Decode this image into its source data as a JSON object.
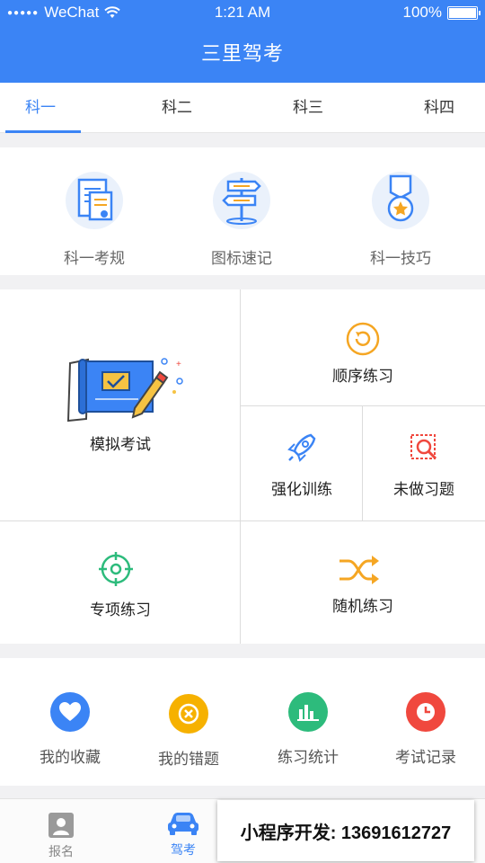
{
  "status_bar": {
    "carrier": "WeChat",
    "time": "1:21 AM",
    "battery": "100%"
  },
  "app_title": "三里驾考",
  "tabs": [
    {
      "label": "科一"
    },
    {
      "label": "科二"
    },
    {
      "label": "科三"
    },
    {
      "label": "科四"
    }
  ],
  "quick_links": [
    {
      "label": "科一考规",
      "icon": "document-rules-icon"
    },
    {
      "label": "图标速记",
      "icon": "signpost-icon"
    },
    {
      "label": "科一技巧",
      "icon": "medal-icon"
    }
  ],
  "practice": {
    "mock_exam": "模拟考试",
    "sequential": "顺序练习",
    "intensive": "强化训练",
    "undone": "未做习题",
    "special": "专项练习",
    "random": "随机练习"
  },
  "personal": [
    {
      "label": "我的收藏",
      "icon": "heart-icon",
      "color": "#3b84f5"
    },
    {
      "label": "我的错题",
      "icon": "wrong-icon",
      "color": "#f6b100"
    },
    {
      "label": "练习统计",
      "icon": "stats-icon",
      "color": "#2dbb7c"
    },
    {
      "label": "考试记录",
      "icon": "clock-icon",
      "color": "#f0483e"
    }
  ],
  "tabbar": {
    "register": "报名",
    "exam": "驾考"
  },
  "promo": "小程序开发: 13691612727",
  "colors": {
    "primary": "#3b84f5",
    "green": "#2dbb7c",
    "yellow": "#f6b100",
    "red": "#f0483e",
    "orange": "#f5a623"
  }
}
